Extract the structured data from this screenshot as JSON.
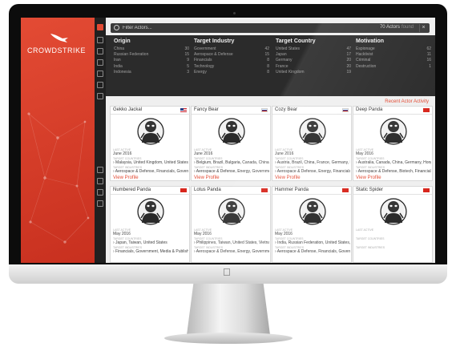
{
  "brand": {
    "name": "CROWDSTRIKE",
    "accent": "#e34b34"
  },
  "filter": {
    "placeholder": "Filter Actors...",
    "count": "70 Actors",
    "count_suffix": "found",
    "clear": "×"
  },
  "stats": [
    {
      "title": "Origin",
      "rows": [
        {
          "label": "China",
          "count": "30"
        },
        {
          "label": "Russian Federation",
          "count": "15"
        },
        {
          "label": "Iran",
          "count": "9"
        },
        {
          "label": "India",
          "count": "5"
        },
        {
          "label": "Indonesia",
          "count": "3"
        }
      ]
    },
    {
      "title": "Target Industry",
      "rows": [
        {
          "label": "Government",
          "count": "42"
        },
        {
          "label": "Aerospace & Defense",
          "count": "15"
        },
        {
          "label": "Financials",
          "count": "8"
        },
        {
          "label": "Technology",
          "count": "8"
        },
        {
          "label": "Energy",
          "count": "8"
        }
      ]
    },
    {
      "title": "Target Country",
      "rows": [
        {
          "label": "United States",
          "count": "47"
        },
        {
          "label": "Japan",
          "count": "17"
        },
        {
          "label": "Germany",
          "count": "20"
        },
        {
          "label": "France",
          "count": "20"
        },
        {
          "label": "United Kingdom",
          "count": "19"
        }
      ]
    },
    {
      "title": "Motivation",
      "rows": [
        {
          "label": "Espionage",
          "count": "62"
        },
        {
          "label": "Hacktivist",
          "count": "11"
        },
        {
          "label": "Criminal",
          "count": "16"
        },
        {
          "label": "Destruction",
          "count": "1"
        },
        {
          "label": "",
          "count": ""
        }
      ]
    }
  ],
  "recent_activity": "Recent Actor Activity",
  "labels": {
    "last_active": "Last active",
    "target_countries": "Target countries",
    "target_industries": "Target industries",
    "view": "View Profile"
  },
  "actors": [
    {
      "name": "Gekko Jackal",
      "flag": "us",
      "date": "June 2016",
      "countries": "› Malaysia, United Kingdom, United States",
      "industries": "› Aerospace & Defense, Financials, Governmen..."
    },
    {
      "name": "Fancy Bear",
      "flag": "ru",
      "date": "June 2016",
      "countries": "› Belgium, Brazil, Bulgaria, Canada, China, Fi...",
      "industries": "› Aerospace & Defense, Energy, Government,..."
    },
    {
      "name": "Cozy Bear",
      "flag": "ru",
      "date": "June 2016",
      "countries": "› Austria, Brazil, China, France, Germany, Ru...",
      "industries": "› Aerospace & Defense, Energy, Financials, G..."
    },
    {
      "name": "Deep Panda",
      "flag": "cn",
      "date": "May 2016",
      "countries": "› Australia, Canada, China, Germany, Hong Ko...",
      "industries": "› Aerospace & Defense, Biotech, Financials, ..."
    },
    {
      "name": "Numbered Panda",
      "flag": "cn",
      "date": "May 2016",
      "countries": "› Japan, Taiwan, United States",
      "industries": "› Financials, Government, Media & Publishing..."
    },
    {
      "name": "Lotus Panda",
      "flag": "cn",
      "date": "May 2016",
      "countries": "› Philippines, Taiwan, United States, Vietnam",
      "industries": "› Aerospace & Defense, Energy, Government,..."
    },
    {
      "name": "Hammer Panda",
      "flag": "cn",
      "date": "May 2016",
      "countries": "› India, Russian Federation, United States, Uz...",
      "industries": "› Aerospace & Defense, Financials, Governme..."
    },
    {
      "name": "Static Spider",
      "flag": "cn",
      "date": "",
      "countries": "",
      "industries": ""
    }
  ]
}
